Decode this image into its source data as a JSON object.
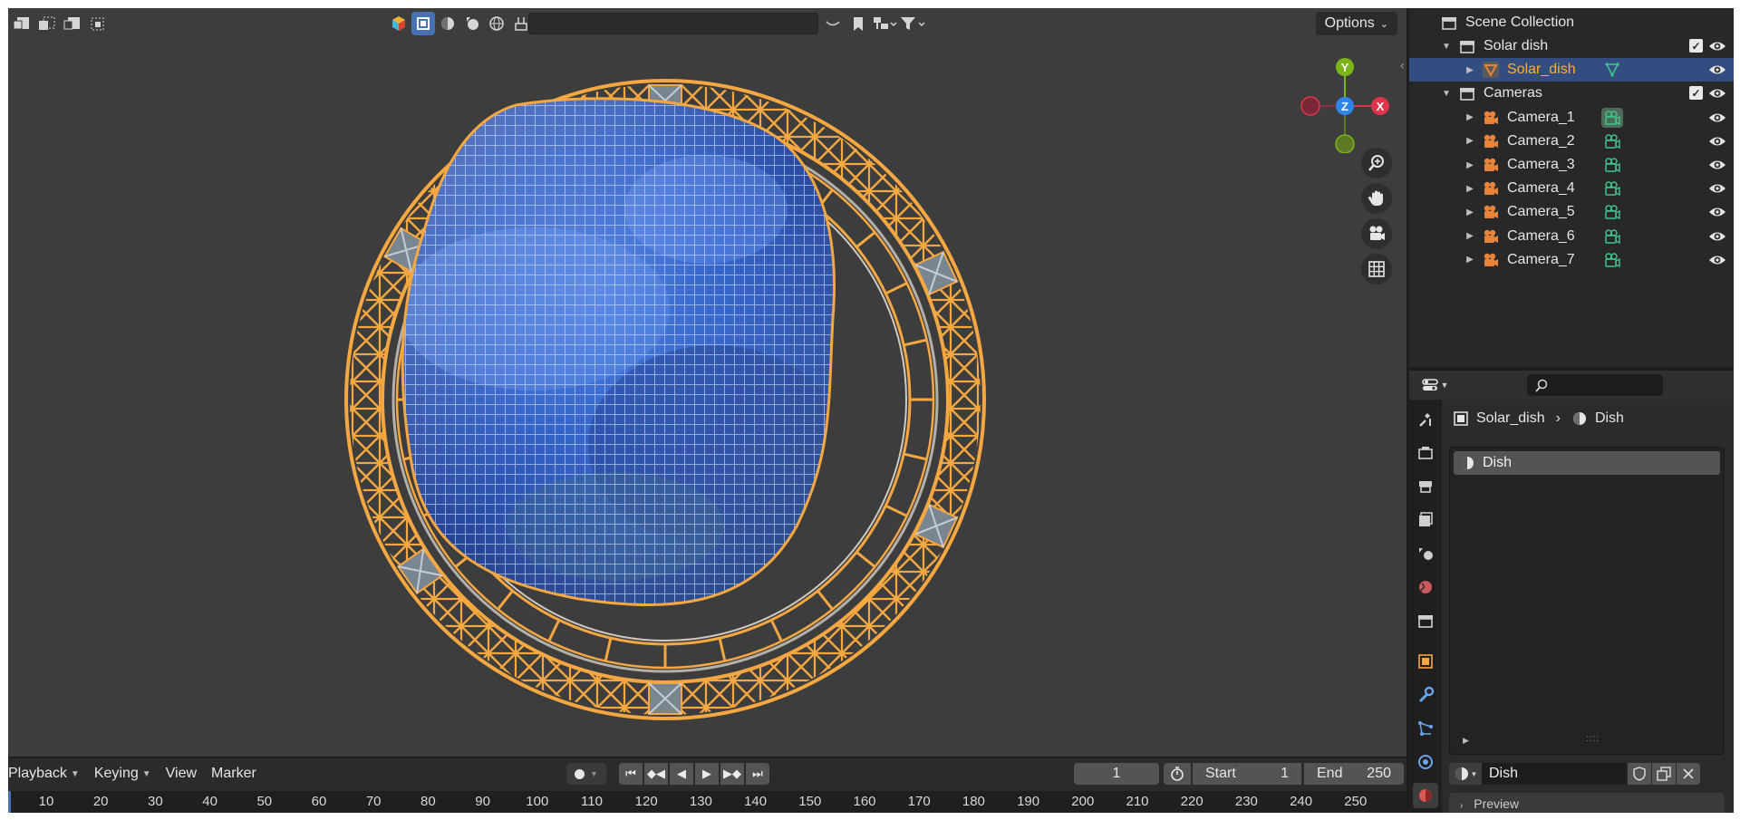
{
  "viewport": {
    "search": {
      "placeholder": "",
      "value": ""
    },
    "options_label": "Options",
    "gizmo": {
      "x": "X",
      "y": "Y",
      "z": "Z"
    }
  },
  "outliner": {
    "scene_collection": "Scene Collection",
    "rows": [
      {
        "label": "Solar dish",
        "type": "collection"
      },
      {
        "label": "Solar_dish",
        "type": "mesh"
      },
      {
        "label": "Cameras",
        "type": "collection"
      },
      {
        "label": "Camera_1",
        "type": "camera"
      },
      {
        "label": "Camera_2",
        "type": "camera"
      },
      {
        "label": "Camera_3",
        "type": "camera"
      },
      {
        "label": "Camera_4",
        "type": "camera"
      },
      {
        "label": "Camera_5",
        "type": "camera"
      },
      {
        "label": "Camera_6",
        "type": "camera"
      },
      {
        "label": "Camera_7",
        "type": "camera"
      }
    ]
  },
  "properties": {
    "search": {
      "placeholder": ""
    },
    "breadcrumb": {
      "object": "Solar_dish",
      "material": "Dish"
    },
    "material_slot": "Dish",
    "material_name": "Dish",
    "preview_label": "Preview"
  },
  "timeline": {
    "menus": [
      "Playback",
      "Keying",
      "View",
      "Marker"
    ],
    "current_frame": "1",
    "start_label": "Start",
    "start_value": "1",
    "end_label": "End",
    "end_value": "250",
    "ruler_ticks": [
      "10",
      "20",
      "30",
      "40",
      "50",
      "60",
      "70",
      "80",
      "90",
      "100",
      "110",
      "120",
      "130",
      "140",
      "150",
      "160",
      "170",
      "180",
      "190",
      "200",
      "210",
      "220",
      "230",
      "240",
      "250"
    ]
  },
  "colors": {
    "accent": "#4772b3",
    "selection_orange": "#f5a742",
    "axis_x": "#e0344a",
    "axis_y": "#7bb518",
    "axis_z": "#2f86e8",
    "camera_orange": "#e8833a",
    "data_green": "#3ec58d"
  }
}
